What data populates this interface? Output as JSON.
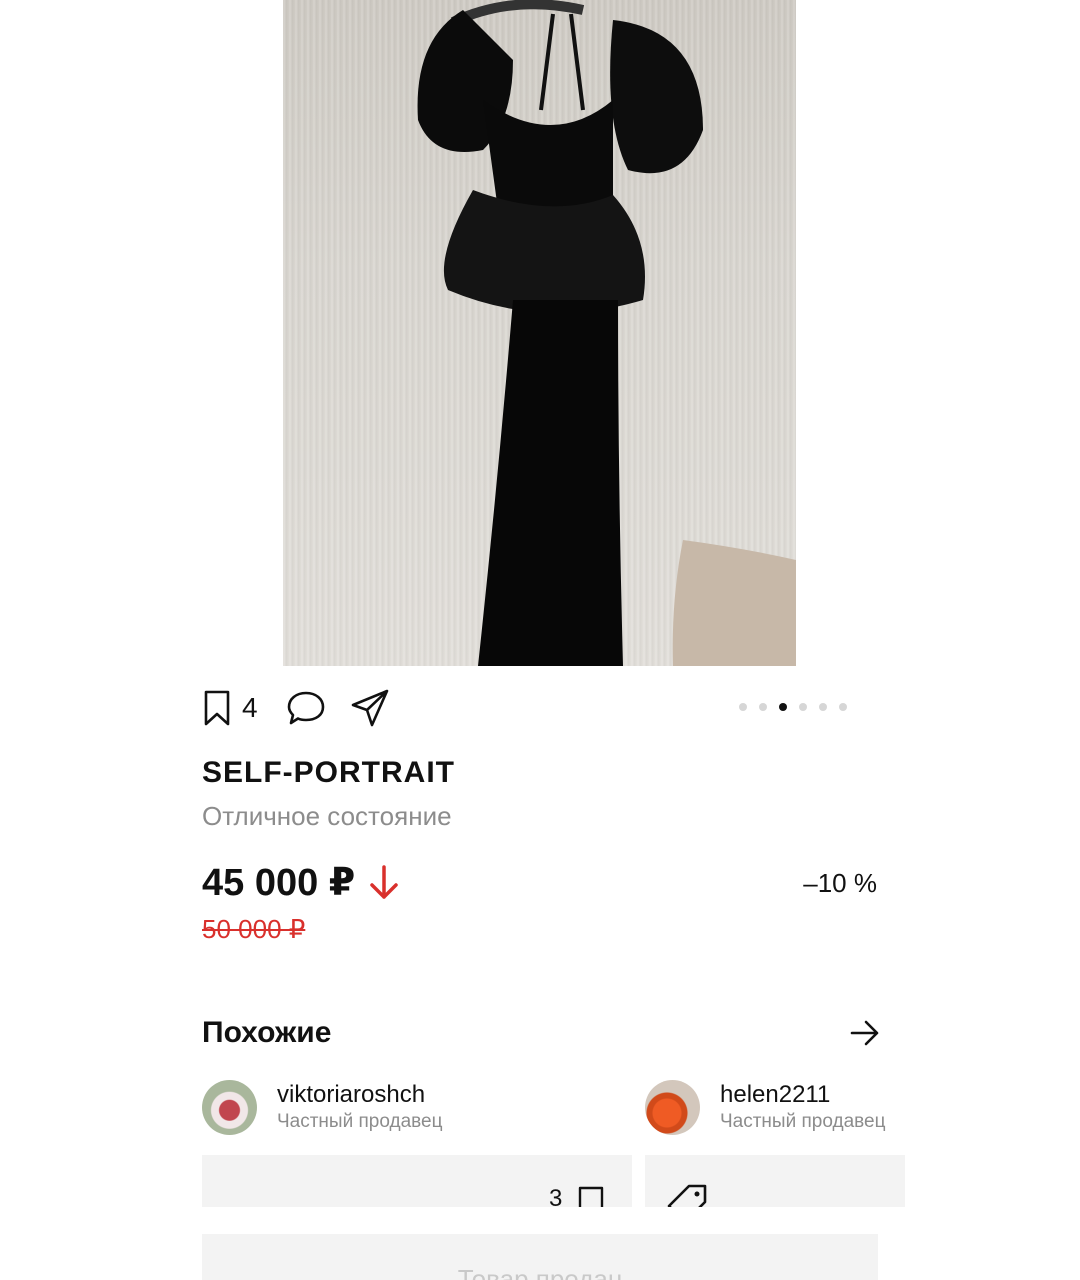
{
  "product": {
    "image_alt": "black dress on hanger",
    "bookmark_count": "4",
    "brand": "SELF-PORTRAIT",
    "condition": "Отличное состояние",
    "price": "45 000 ₽",
    "old_price": "50 000 ₽",
    "discount": "–10 %",
    "carousel": {
      "total": 6,
      "active_index": 2
    }
  },
  "icons": {
    "bookmark": "bookmark-icon",
    "comment": "comment-icon",
    "share": "share-icon",
    "price_down": "arrow-down-icon",
    "similar_arrow": "arrow-right-icon",
    "tag": "tag-icon"
  },
  "colors": {
    "accent_red": "#d9302c",
    "muted_text": "#8c8c8c",
    "card_bg": "#f3f3f3"
  },
  "similar": {
    "title": "Похожие",
    "sellers": [
      {
        "name": "viktoriaroshch",
        "type": "Частный продавец"
      },
      {
        "name": "helen2211",
        "type": "Частный продавец"
      }
    ],
    "cards": [
      {
        "bookmark_count": "3"
      },
      {}
    ]
  },
  "footer": {
    "sold_label": "Товар продан"
  }
}
